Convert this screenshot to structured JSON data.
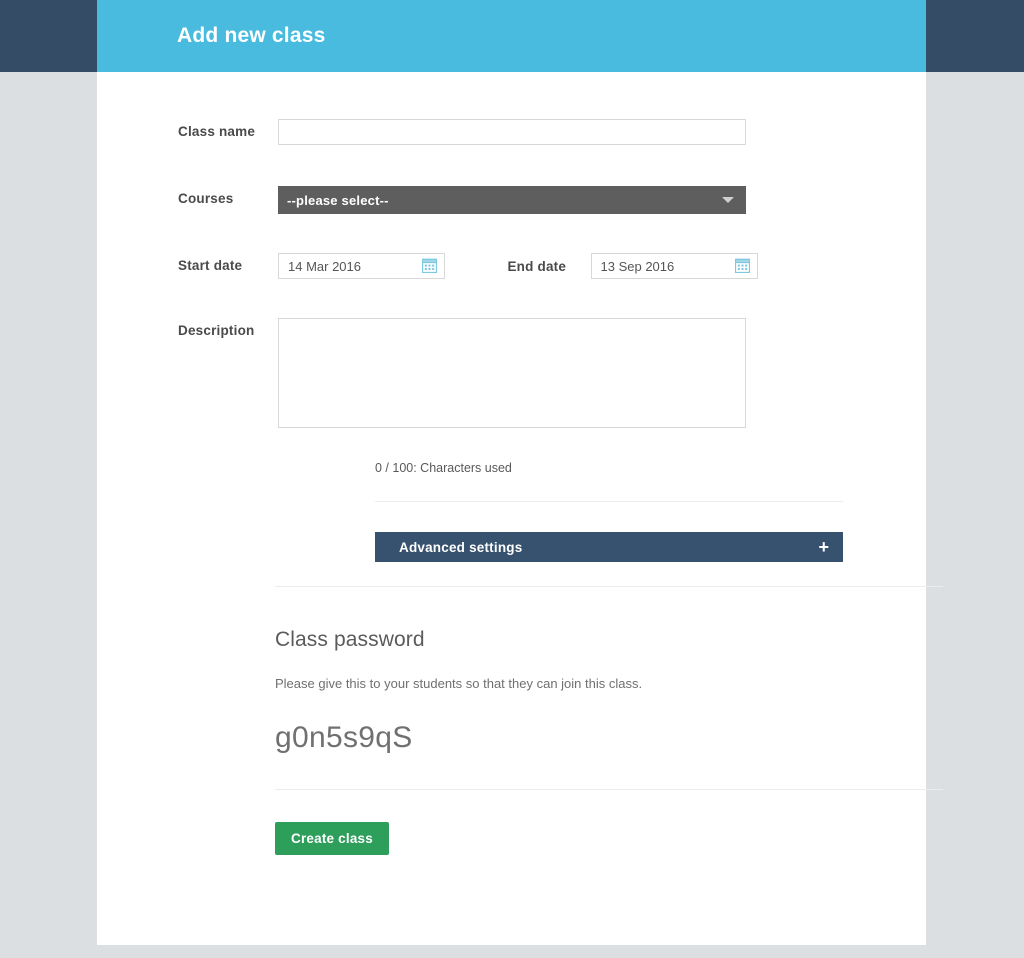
{
  "header": {
    "title": "Add new class"
  },
  "form": {
    "class_name": {
      "label": "Class name",
      "value": "",
      "placeholder": ""
    },
    "courses": {
      "label": "Courses",
      "selected": "--please select--",
      "caret_icon": "chevron-down-icon"
    },
    "start_date": {
      "label": "Start date",
      "value": "14 Mar 2016",
      "icon": "calendar-icon"
    },
    "end_date": {
      "label": "End date",
      "value": "13 Sep 2016",
      "icon": "calendar-icon"
    },
    "description": {
      "label": "Description",
      "value": "",
      "placeholder": ""
    },
    "character_counter": "0 / 100: Characters used"
  },
  "advanced_settings": {
    "label": "Advanced settings",
    "expand_icon": "plus-icon",
    "expand_symbol": "+"
  },
  "class_password": {
    "title": "Class password",
    "description": "Please give this to your students so that they can join this class.",
    "value": "g0n5s9qS"
  },
  "actions": {
    "create_label": "Create class"
  },
  "colors": {
    "header_blue": "#48bbdf",
    "topbar_navy": "#344c66",
    "page_background": "#dcdfe2",
    "select_gray": "#5e5e5e",
    "advanced_navy": "#37526f",
    "create_green": "#2e9e5b",
    "calendar_icon_blue": "#7ec8e0"
  }
}
